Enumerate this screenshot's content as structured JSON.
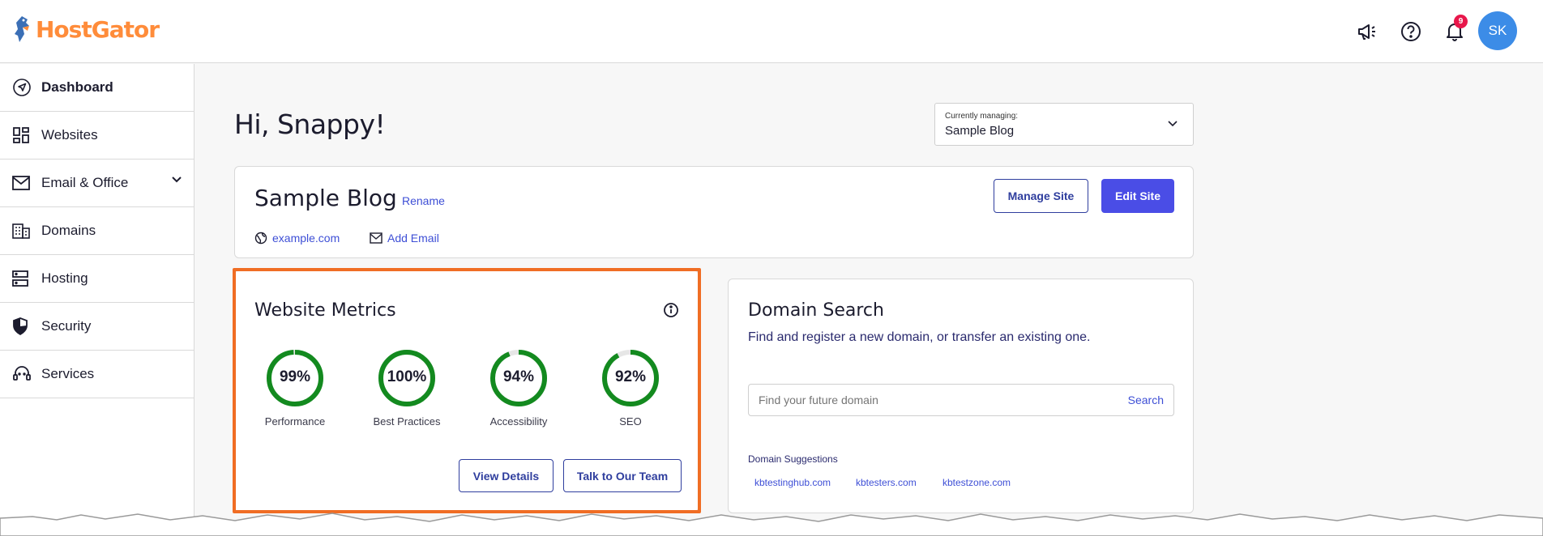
{
  "brand": {
    "name": "HostGator",
    "color": "#ff8c3a"
  },
  "topbar": {
    "icons": [
      "megaphone-icon",
      "help-icon",
      "bell-icon"
    ],
    "notification_count": "9",
    "avatar_initials": "SK"
  },
  "sidebar": {
    "items": [
      {
        "label": "Dashboard",
        "icon": "navigation-icon",
        "active": true
      },
      {
        "label": "Websites",
        "icon": "dashboard-grid-icon"
      },
      {
        "label": "Email & Office",
        "icon": "envelope-icon",
        "expandable": true
      },
      {
        "label": "Domains",
        "icon": "building-icon"
      },
      {
        "label": "Hosting",
        "icon": "server-icon"
      },
      {
        "label": "Security",
        "icon": "shield-icon"
      },
      {
        "label": "Services",
        "icon": "support-agent-icon"
      }
    ]
  },
  "main": {
    "greeting": "Hi, Snappy!",
    "managing": {
      "label": "Currently managing:",
      "value": "Sample Blog"
    },
    "site": {
      "title": "Sample Blog",
      "rename": "Rename",
      "domain": "example.com",
      "add_email": "Add Email",
      "manage_button": "Manage Site",
      "edit_button": "Edit Site"
    },
    "metrics": {
      "title": "Website Metrics",
      "items": [
        {
          "label": "Performance",
          "value": "99%",
          "fraction": 0.99
        },
        {
          "label": "Best Practices",
          "value": "100%",
          "fraction": 1.0
        },
        {
          "label": "Accessibility",
          "value": "94%",
          "fraction": 0.94
        },
        {
          "label": "SEO",
          "value": "92%",
          "fraction": 0.92
        }
      ],
      "view_details": "View Details",
      "talk_team": "Talk to Our Team"
    },
    "domain_search": {
      "title": "Domain Search",
      "subtitle": "Find and register a new domain, or transfer an existing one.",
      "placeholder": "Find your future domain",
      "search_label": "Search",
      "suggestions_title": "Domain Suggestions",
      "suggestions": [
        "kbtestinghub.com",
        "kbtesters.com",
        "kbtestzone.com"
      ]
    }
  },
  "colors": {
    "accent": "#4a4de6",
    "link": "#3e4fd6",
    "gauge_green": "#138a1f",
    "highlight": "#f06d24"
  }
}
